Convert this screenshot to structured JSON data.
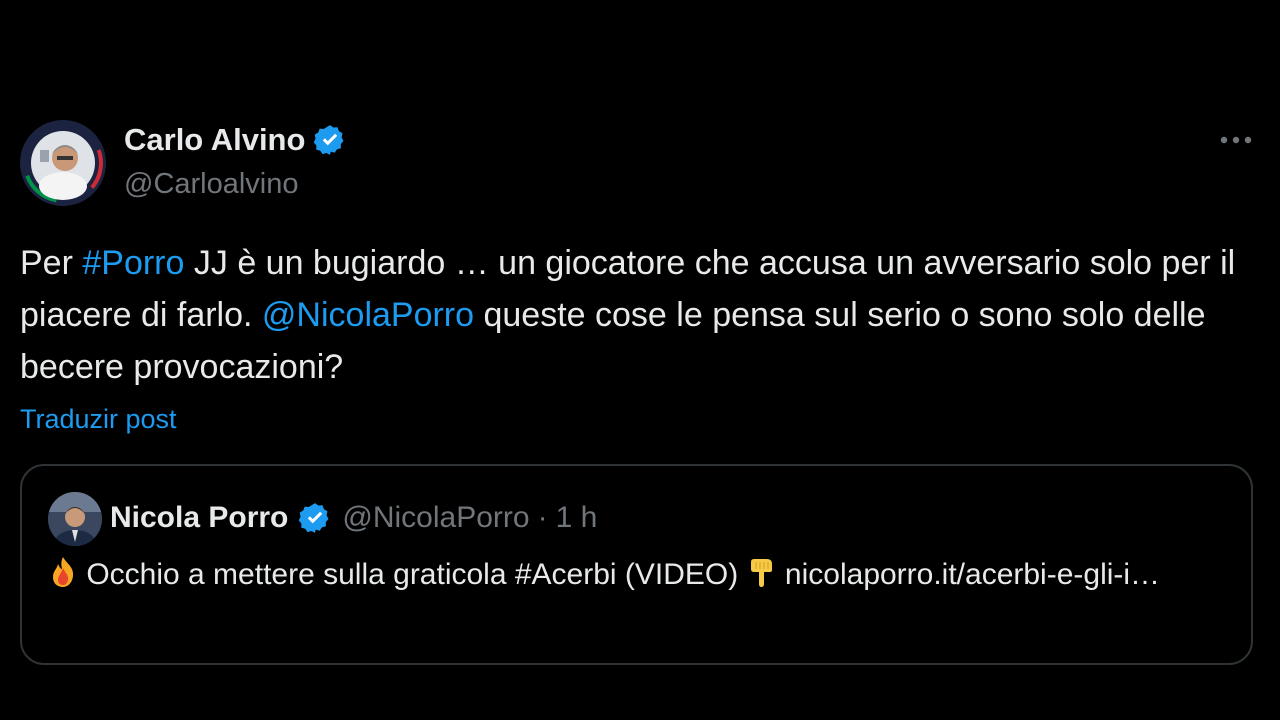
{
  "tweet": {
    "author": {
      "name": "Carlo Alvino",
      "handle": "@Carloalvino",
      "verified": true
    },
    "text": {
      "part1": "Per ",
      "hashtag": "#Porro",
      "part2": "  JJ è un bugiardo … un giocatore che accusa un avversario solo per il piacere di farlo. ",
      "mention": "@NicolaPorro",
      "part3": " queste cose le pensa sul serio o sono solo delle becere provocazioni?"
    },
    "translate_label": "Traduzir post",
    "more_icon": "more-horizontal-icon"
  },
  "quote": {
    "author": {
      "name": "Nicola Porro",
      "handle": "@NicolaPorro",
      "verified": true
    },
    "dot": "·",
    "time": "1 h",
    "text": {
      "emoji1": "flame-emoji",
      "part1": " Occhio a mettere sulla graticola #Acerbi (VIDEO) ",
      "emoji2": "pointing-down-emoji",
      "part2": " nicolaporro.it/acerbi-e-gli-i…"
    }
  },
  "colors": {
    "background": "#000000",
    "text": "#e7e9ea",
    "secondary": "#71767b",
    "accent": "#1d9bf0",
    "border": "#2f3336"
  }
}
